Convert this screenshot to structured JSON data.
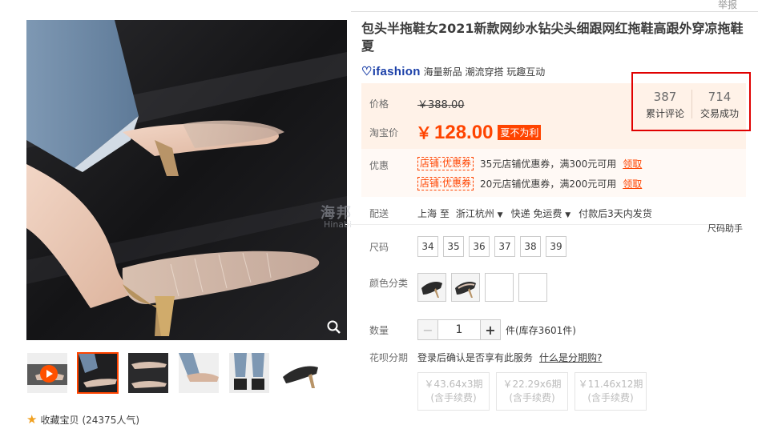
{
  "header": {
    "report": "举报"
  },
  "product": {
    "title": "包头半拖鞋女2021新款网纱水钻尖头细跟网红拖鞋高跟外穿凉拖鞋夏",
    "brand": {
      "logo": "ifashion",
      "tags": "海量新品 潮流穿搭 玩趣互动"
    }
  },
  "price": {
    "label": "价格",
    "old": "￥388.00",
    "taobao_label": "淘宝价",
    "currency": "￥",
    "current": "128.00",
    "badge": "夏不为利"
  },
  "stats": {
    "reviews_count": "387",
    "reviews_label": "累计评论",
    "deals_count": "714",
    "deals_label": "交易成功"
  },
  "coupons": {
    "label": "优惠",
    "items": [
      {
        "tag": "店铺:优惠券",
        "text": "35元店铺优惠券，满300元可用",
        "action": "领取"
      },
      {
        "tag": "店铺:优惠券",
        "text": "20元店铺优惠券，满200元可用",
        "action": "领取"
      }
    ]
  },
  "shipping": {
    "label": "配送",
    "from": "上海 至",
    "to": "浙江杭州",
    "method": "快递 免运费",
    "time": "付款后3天内发货"
  },
  "watermark": {
    "main": "海邦",
    "sub": "Hinabi"
  },
  "size_helper": "尺码助手",
  "sizes": {
    "label": "尺码",
    "options": [
      "34",
      "35",
      "36",
      "37",
      "38",
      "39"
    ]
  },
  "colors": {
    "label": "颜色分类"
  },
  "quantity": {
    "label": "数量",
    "minus": "−",
    "value": "1",
    "plus": "+",
    "stock": "件(库存3601件)"
  },
  "huabei": {
    "label": "花呗分期",
    "note": "登录后确认是否享有此服务",
    "link": "什么是分期购?",
    "plans": [
      {
        "price": "￥43.64x3期",
        "fee": "(含手续费)"
      },
      {
        "price": "￥22.29x6期",
        "fee": "(含手续费)"
      },
      {
        "price": "￥11.46x12期",
        "fee": "(含手续费)"
      }
    ]
  },
  "favorite": {
    "label": "收藏宝贝",
    "count": "(24375人气)"
  },
  "colors_palette": {
    "accent": "#ff4400",
    "price_bg": "#fff2e8",
    "brand": "#1a3fa8",
    "highlight_border": "#e00000"
  }
}
